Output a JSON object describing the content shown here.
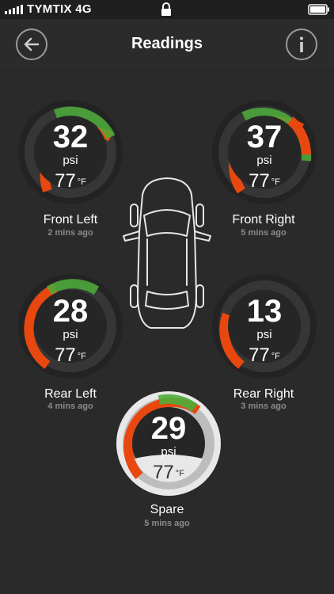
{
  "status_bar": {
    "carrier": "TYMTIX 4G",
    "signal_icon": "signal-bars-icon",
    "lock_icon": "lock-icon",
    "battery_icon": "battery-icon"
  },
  "nav": {
    "title": "Readings",
    "back_icon": "arrow-left-icon",
    "info_icon": "info-icon"
  },
  "tires": {
    "front_left": {
      "pressure": "32",
      "unit": "psi",
      "temp": "77",
      "temp_unit": "°F",
      "label": "Front Left",
      "time": "2 mins ago"
    },
    "front_right": {
      "pressure": "37",
      "unit": "psi",
      "temp": "77",
      "temp_unit": "°F",
      "label": "Front Right",
      "time": "5 mins ago"
    },
    "rear_left": {
      "pressure": "28",
      "unit": "psi",
      "temp": "77",
      "temp_unit": "°F",
      "label": "Rear Left",
      "time": "4 mins ago"
    },
    "rear_right": {
      "pressure": "13",
      "unit": "psi",
      "temp": "77",
      "temp_unit": "°F",
      "label": "Rear Right",
      "time": "3 mins ago"
    },
    "spare": {
      "pressure": "29",
      "unit": "psi",
      "temp": "77",
      "temp_unit": "°F",
      "label": "Spare",
      "time": "5 mins ago"
    }
  },
  "colors": {
    "background": "#2b2b2b",
    "gauge_red": "#e84a12",
    "gauge_green": "#4caf38",
    "muted_text": "#8a8a8a"
  }
}
